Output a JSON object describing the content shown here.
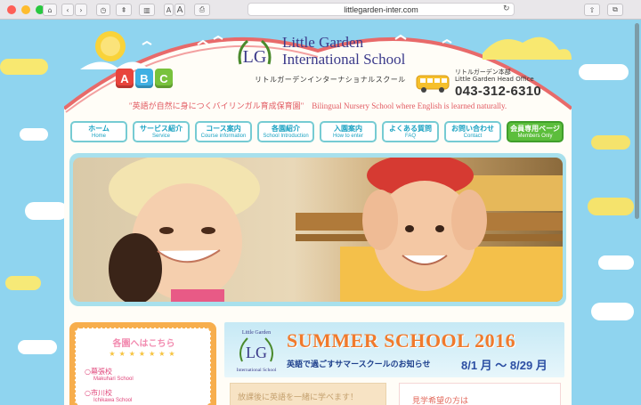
{
  "browser": {
    "url": "littlegarden-inter.com",
    "font_small": "A",
    "font_large": "A"
  },
  "header": {
    "logo_line1": "Little Garden",
    "logo_line2": "International School",
    "logo_badge": "LG",
    "logo_sub": "リトルガーデンインターナショナルスクール",
    "abc": [
      "A",
      "B",
      "C"
    ],
    "office_jp": "リトルガーデン本部",
    "office_en": "Little Garden Head Office",
    "phone": "043-312-6310",
    "tagline": "\"英語が自然に身につくバイリンガル育成保育園\"　Bilingual Nursery School where English is learned naturally."
  },
  "nav": [
    {
      "jp": "ホーム",
      "en": "Home"
    },
    {
      "jp": "サービス紹介",
      "en": "Service"
    },
    {
      "jp": "コース案内",
      "en": "Course information"
    },
    {
      "jp": "各園紹介",
      "en": "School Introduction"
    },
    {
      "jp": "入園案内",
      "en": "How to enter"
    },
    {
      "jp": "よくある質問",
      "en": "FAQ"
    },
    {
      "jp": "お問い合わせ",
      "en": "Contact"
    },
    {
      "jp": "会員専用ページ",
      "en": "Members Only"
    }
  ],
  "schools": {
    "title": "各園へはこちら",
    "stars": "★★★★★★★",
    "items": [
      {
        "jp": "○幕張校",
        "en": "Makuhari School"
      },
      {
        "jp": "○市川校",
        "en": "Ichikawa School"
      }
    ]
  },
  "summer": {
    "title": "SUMMER SCHOOL 2016",
    "sub": "英語で過ごすサマースクールのお知らせ",
    "dates": "8/1 月 ～ 8/29 月",
    "logo_line1": "Little Garden",
    "logo_line2": "International School"
  },
  "box2": {
    "text": "放課後に英語を一緒に学べます！"
  },
  "box3": {
    "text": "見学希望の方は"
  },
  "colors": {
    "accent": "#1aa2c2",
    "member": "#5cbe3c",
    "sky": "#8fd4ef"
  }
}
